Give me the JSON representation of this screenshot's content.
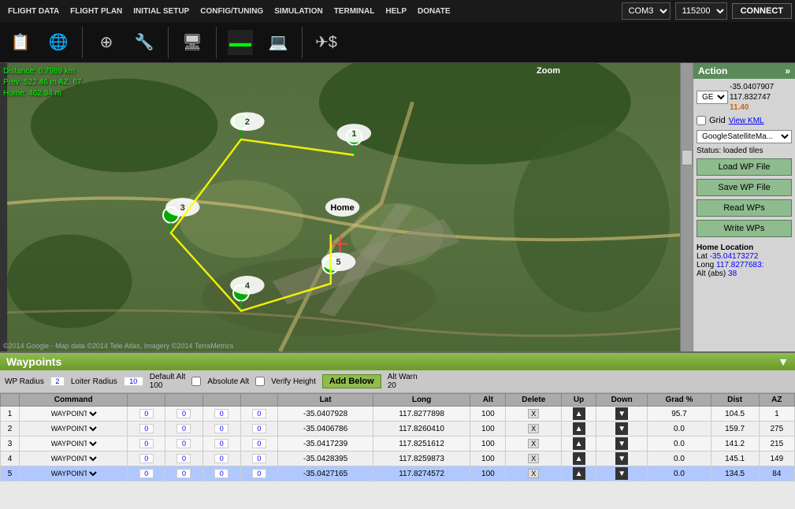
{
  "menu": {
    "items": [
      "FLIGHT DATA",
      "FLIGHT PLAN",
      "INITIAL SETUP",
      "CONFIG/TUNING",
      "SIMULATION",
      "TERMINAL",
      "HELP",
      "DONATE"
    ]
  },
  "toolbar": {
    "buttons": [
      {
        "name": "flight-data-btn",
        "icon": "📋"
      },
      {
        "name": "flight-plan-btn",
        "icon": "🌐"
      },
      {
        "name": "initial-setup-btn",
        "icon": "⚙"
      },
      {
        "name": "config-tuning-btn",
        "icon": "🔧"
      },
      {
        "name": "simulation-btn",
        "icon": "🖥"
      },
      {
        "name": "terminal-btn",
        "icon": "⬛"
      },
      {
        "name": "help-btn",
        "icon": "💻"
      },
      {
        "name": "donate-btn",
        "icon": "✈"
      }
    ],
    "com_port": "COM3",
    "baud_rate": "115200",
    "connect_label": "CONNECT"
  },
  "map": {
    "distance_label": "Distance: 0.7989 km",
    "prev_label": "Prev: 522.46 m AZ: 67",
    "home_label": "Home: 462.94 m",
    "copyright": "©2014 Google - Map data ©2014 Tele Atlas, Imagery ©2014 TerraMetrics",
    "zoom_label": "Zoom"
  },
  "action_panel": {
    "title": "Action",
    "expand_icon": "»",
    "coord_type": "GEO",
    "lat": "-35.0407907",
    "lon": "117.832747",
    "alt": "11.40",
    "grid_label": "Grid",
    "view_kml_label": "View KML",
    "map_type": "GoogleSatelliteMa...",
    "status": "Status: loaded tiles",
    "load_wp_label": "Load WP File",
    "save_wp_label": "Save WP File",
    "read_wps_label": "Read WPs",
    "write_wps_label": "Write WPs",
    "home_location_title": "Home Location",
    "home_lat_label": "Lat",
    "home_lat_val": "-35.04173272",
    "home_lon_label": "Long",
    "home_lon_val": "117.8277683:",
    "home_alt_label": "Alt (abs)",
    "home_alt_val": "38"
  },
  "waypoints": {
    "title": "Waypoints",
    "toolbar": {
      "wp_radius_label": "WP Radius",
      "wp_radius_val": "2",
      "loiter_radius_label": "Loiter Radius",
      "loiter_radius_val": "10",
      "default_alt_label": "Default Alt",
      "default_alt_val": "100",
      "absolute_alt_label": "Absolute Alt",
      "verify_height_label": "Verify Height",
      "add_below_label": "Add Below",
      "alt_warn_label": "Alt Warn",
      "alt_warn_val": "20"
    },
    "columns": [
      "",
      "Command",
      "",
      "",
      "",
      "",
      "Lat",
      "Long",
      "Alt",
      "Delete",
      "Up",
      "Down",
      "Grad %",
      "Dist",
      "AZ"
    ],
    "rows": [
      {
        "id": 1,
        "command": "WAYPOINT",
        "p1": "0",
        "p2": "0",
        "p3": "0",
        "p4": "0",
        "lat": "-35.0407928",
        "lon": "117.8277898",
        "alt": "100",
        "delete": "X",
        "grad": "95.7",
        "dist": "104.5",
        "az": "1",
        "selected": false
      },
      {
        "id": 2,
        "command": "WAYPOINT",
        "p1": "0",
        "p2": "0",
        "p3": "0",
        "p4": "0",
        "lat": "-35.0406786",
        "lon": "117.8260410",
        "alt": "100",
        "delete": "X",
        "grad": "0.0",
        "dist": "159.7",
        "az": "275",
        "selected": false
      },
      {
        "id": 3,
        "command": "WAYPOINT",
        "p1": "0",
        "p2": "0",
        "p3": "0",
        "p4": "0",
        "lat": "-35.0417239",
        "lon": "117.8251612",
        "alt": "100",
        "delete": "X",
        "grad": "0.0",
        "dist": "141.2",
        "az": "215",
        "selected": false
      },
      {
        "id": 4,
        "command": "WAYPOINT",
        "p1": "0",
        "p2": "0",
        "p3": "0",
        "p4": "0",
        "lat": "-35.0428395",
        "lon": "117.8259873",
        "alt": "100",
        "delete": "X",
        "grad": "0.0",
        "dist": "145.1",
        "az": "149",
        "selected": false
      },
      {
        "id": 5,
        "command": "WAYPOINT",
        "p1": "0",
        "p2": "0",
        "p3": "0",
        "p4": "0",
        "lat": "-35.0427165",
        "lon": "117.8274572",
        "alt": "100",
        "delete": "X",
        "grad": "0.0",
        "dist": "134.5",
        "az": "84",
        "selected": true
      }
    ]
  }
}
